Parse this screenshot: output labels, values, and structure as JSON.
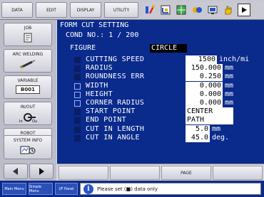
{
  "toolbar": {
    "tabs": [
      "DATA",
      "EDIT",
      "DISPLAY",
      "UTILITY"
    ],
    "icons": [
      "robot-coord-icon",
      "monitor-icon",
      "grid-icon",
      "jog-icon",
      "screen-icon",
      "hand-icon",
      "play-icon"
    ]
  },
  "sidebar": {
    "job": "JOB",
    "arc_welding": "ARC WELDING",
    "variable": "VARIABLE",
    "variable_box": "B001",
    "inout": "IN/OUT",
    "robot": "ROBOT",
    "system_info": "SYSTEM INFO"
  },
  "screen": {
    "title": "FORM CUT SETTING",
    "cond_no": "COND NO.: 1 / 200",
    "figure_label": "FIGURE",
    "figure_value": "CIRCLE",
    "rows": [
      {
        "label": "CUTTING SPEED",
        "value": "1500",
        "unit": "inch/mi",
        "checked": true
      },
      {
        "label": "RADIUS",
        "value": "150.000",
        "unit": "mm",
        "checked": true
      },
      {
        "label": "ROUNDNESS ERR",
        "value": "0.250",
        "unit": "mm",
        "checked": true
      },
      {
        "label": "WIDTH",
        "value": "0.000",
        "unit": "mm",
        "checked": false
      },
      {
        "label": "HEIGHT",
        "value": "0.000",
        "unit": "mm",
        "checked": false
      },
      {
        "label": "CORNER RADIUS",
        "value": "0.000",
        "unit": "mm",
        "checked": false
      },
      {
        "label": "START POINT",
        "value": "CENTER",
        "unit": "",
        "checked": true
      },
      {
        "label": "END POINT",
        "value": "PATH",
        "unit": "",
        "checked": true
      },
      {
        "label": "CUT IN LENGTH",
        "value": "5.0",
        "unit": "mm",
        "checked": true
      },
      {
        "label": "CUT IN ANGLE",
        "value": "45.0",
        "unit": "deg.",
        "checked": true
      }
    ]
  },
  "fkeys": [
    "",
    "",
    "PAGE",
    ""
  ],
  "status": {
    "main_menu": "Main Menu",
    "simple_menu": "Simple Menu",
    "io_panel": "I/F Panel",
    "message": "Please set (■) data only"
  },
  "colors": {
    "screen_bg": "#0a2a8c",
    "panel_bg": "#d9d9e3"
  }
}
